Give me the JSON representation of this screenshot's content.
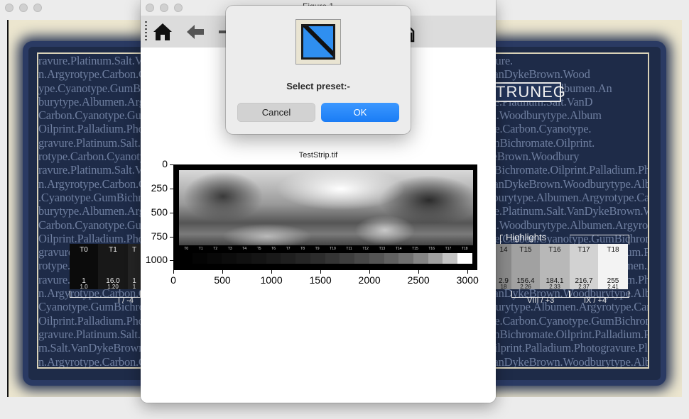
{
  "background_window": {
    "poster_text_lines": [
      "ravure.Platinum.Salt.VanDykeBrown.Woodburytype.GumBichromate.Oilprint.Palladium.Photogravure.",
      "n.Argyrotype.Carbon.Cyanotype.GumBichromate.Oilprint.Palladium.Photogravure.Platinum.Salt.VanDykeBrown.Wood",
      "ype.Cyanotype.GumBichromate.Oilprint.Palladium.Photogravure.Platinum.Salt.VanDykeBrown.Woodburytype.Albumen.An",
      "burytype.Albumen.Argyrotype.Carbon.Cyanotype.GumBichromate.Oilprint.Palladium.Photogravure.Platinum.Salt.VanD",
      "Carbon.Cyanotype.GumBichromate.Oilprint.Palladium.Photogravure.Platinum.Salt.VanDykeBrown.Woodburytype.Album",
      "Oilprint.Palladium.Photogravure.Platinum.Salt.VanDykeBrown.Woodburytype.Albumen.Argyrotype.Carbon.Cyanotype.",
      "gravure.Platinum.Salt.VanDykeBrown.Woodburytype.Albumen.Argyrotype.Carbon.Cyanotype.GumBichromate.Oilprint.",
      "rotype.Carbon.Cyanotype.GumBichromate.Oilprint.Palladium.Photogravure.Platinum.Salt.VanDykeBrown.Woodbury",
      "ravure.Platinum.Salt.VanDykeBrown.Woodburytype.Albumen.Argyrotype.Carbon.Cyanotype.GumBichromate.Oilprint.Palladium.Phot",
      "n.Argyrotype.Carbon.Cyanotype.GumBichromate.Oilprint.Palladium.Photogravure.Platinum.Salt.VanDykeBrown.Woodburytype.Albumen.Ar",
      ".Cyanotype.GumBichromate.Oilprint.Palladium.Photogravure.Platinum.Salt.VanDykeBrown.Woodburytype.Albumen.Argyrotype.Carbon.Cyan",
      "burytype.Albumen.Argyrotype.Carbon.Cyanotype.GumBichromate.Oilprint.Palladium.Photogravure.Platinum.Salt.VanDykeBrown.Woodburytype.Alb",
      "Carbon.Cyanotype.GumBichromate.Oilprint.Palladium.Photogravure.Platinum.Salt.VanDykeBrown.Woodburytype.Albumen.Argyrotype.Carbon.Cyanotype.",
      "Oilprint.Palladium.Photogravure.Platinum.Salt.VanDykeBrown.Woodburytype.Albumen.Argyrotype.Carbon.Cyanotype.GumBichromate.Oilprint.",
      "gravure.Platinum.Salt.VanDykeBrown.Woodburytype.Albumen.Argyrotype.Carbon.Cyanotype.GumBichromate.Oilprint.Palladium.Photogravure",
      "rotype.Carbon.Cyanotype.GumBichromate.Oilprint.Palladium.Photogravure.Platinum.Salt.VanDykeBrown.Woodburytype.Albumen.Argyrotype.",
      "ravure.Platinum.Salt.VanDykeBrown.Woodburytype.Albumen.Argyrotype.Carbon.Cyanotype.GumBichromate.Oilprint.Palladium.Photogravure.Platinum.",
      "n.Argyrotype.Carbon.Cyanotype.GumBichromate.Oilprint.Palladium.Photogravure.Platinum.Salt.VanDykeBrown.Woodburytype.Albumen.Argyrotype.Carbon.",
      "Cyanotype.GumBichromate.Oilprint.Palladium.Photogravure.Platinum.Salt.VanDykeBrown.Woodburytype.Albumen.Argyrotype.Carbon.Cyanotype.Gum",
      "Oilprint.Palladium.Photogravure.Platinum.Salt.VanDykeBrown.Woodburytype.Albumen.Argyrotype.Carbon.Cyanotype.GumBichromate.Oilprint.",
      "gravure.Platinum.Salt.VanDykeBrown.Woodburytype.Albumen.Argyrotype.Carbon.Cyanotype.GumBichromate.Oilprint.Palladium.Photogravure.Platinum.",
      "m.Salt.VanDykeBrown.Woodburytype.Albumen.Argyrotype.Carbon.Cyanotype.GumBichromate.Oilprint.Palladium.Photogravure.Platinum.Salt.VanDykeBrown.",
      "n.Argyrotype.Carbon.Cyanotype.GumBichromate.Oilprint.Palladium.Photogravure.Platinum.Salt.VanDykeBrown.Woodburytype.Albumen.Argyrotype.Carbon.",
      ".Cyanotype.GumBichromate.Oilprint.Palladium.Photogravure.Platinum.Salt.VanDykeBrown.Woodburytype.Albumen.Argyrotype.Carbon.Cyanotype.GumBichromate."
    ],
    "logo_text": "TRUNEG",
    "highlights_label": "Highlights",
    "left_steps": [
      {
        "label": "T0",
        "v1": "1",
        "v2": "1.0",
        "bg": "#0b0b0b"
      },
      {
        "label": "T1",
        "v1": "16.0",
        "v2": "1.20",
        "bg": "#181818"
      },
      {
        "label": "T",
        "v1": "1",
        "v2": "1",
        "bg": "#242424"
      }
    ],
    "left_bracket_label": "I / -4",
    "right_steps": [
      {
        "label": "14",
        "v1": "2.9",
        "v2": "18",
        "bg": "#8a8a8a"
      },
      {
        "label": "T15",
        "v1": "156.4",
        "v2": "2.26",
        "bg": "#a1a1a1"
      },
      {
        "label": "T16",
        "v1": "184.1",
        "v2": "2.33",
        "bg": "#b8b8b8"
      },
      {
        "label": "T17",
        "v1": "216.7",
        "v2": "2.37",
        "bg": "#d2d2d2"
      },
      {
        "label": "T18",
        "v1": "255",
        "v2": "2.41",
        "bg": "#f3f3f3"
      }
    ],
    "right_bracket_label_1": "VIII / +3",
    "right_bracket_label_2": "IX / +4"
  },
  "figure_window": {
    "title": "Figure 1",
    "toolbar": {
      "home_icon": "⌂",
      "back_icon": "←",
      "partial_icon": "⌂"
    },
    "plot": {
      "title": "TestStrip.tif",
      "strip_labels": [
        "T0",
        "T1",
        "T2",
        "T3",
        "T4",
        "T5",
        "T6",
        "T7",
        "T8",
        "T9",
        "T10",
        "T11",
        "T12",
        "T13",
        "T14",
        "T15",
        "T16",
        "T17",
        "T18"
      ]
    }
  },
  "chart_data": {
    "type": "image",
    "title": "TestStrip.tif",
    "x_ticks": [
      0,
      500,
      1000,
      1500,
      2000,
      2500,
      3000
    ],
    "y_ticks": [
      0,
      250,
      500,
      750,
      1000
    ],
    "xlim": [
      0,
      3100
    ],
    "ylim": [
      1100,
      0
    ],
    "patch_gray_levels": [
      4,
      8,
      12,
      16,
      20,
      25,
      31,
      37,
      44,
      52,
      62,
      72,
      84,
      97,
      112,
      133,
      160,
      196,
      255
    ]
  },
  "dialog": {
    "message": "Select preset:-",
    "cancel_label": "Cancel",
    "ok_label": "OK"
  }
}
